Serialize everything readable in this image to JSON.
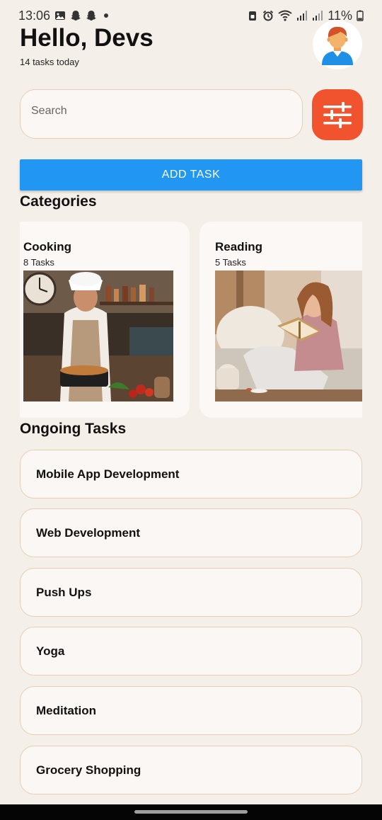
{
  "status_bar": {
    "time": "13:06",
    "battery": "11%",
    "icons": [
      "gallery-icon",
      "snapchat-icon",
      "snapchat-icon",
      "dot-icon",
      "lock-icon",
      "alarm-icon",
      "wifi-icon",
      "signal-icon",
      "signal-icon",
      "battery-icon"
    ]
  },
  "header": {
    "greeting": "Hello, Devs",
    "subtitle": "14 tasks today",
    "avatar_icon": "person-avatar-icon"
  },
  "search": {
    "placeholder": "Search",
    "value": "",
    "filter_icon": "sliders-icon",
    "filter_color": "#f0532d"
  },
  "add_task": {
    "label": "ADD TASK",
    "color": "#2196f3"
  },
  "categories": {
    "title": "Categories",
    "items": [
      {
        "name": "Cooking",
        "count": "8 Tasks",
        "image": "cooking-photo"
      },
      {
        "name": "Reading",
        "count": "5 Tasks",
        "image": "reading-photo"
      }
    ]
  },
  "ongoing": {
    "title": "Ongoing Tasks",
    "items": [
      {
        "label": "Mobile App Development"
      },
      {
        "label": "Web Development"
      },
      {
        "label": "Push Ups"
      },
      {
        "label": "Yoga"
      },
      {
        "label": "Meditation"
      },
      {
        "label": "Grocery Shopping"
      }
    ]
  },
  "colors": {
    "background": "#f5efe9",
    "card_border": "#e8cfb3",
    "card_bg": "#faf7f4"
  }
}
